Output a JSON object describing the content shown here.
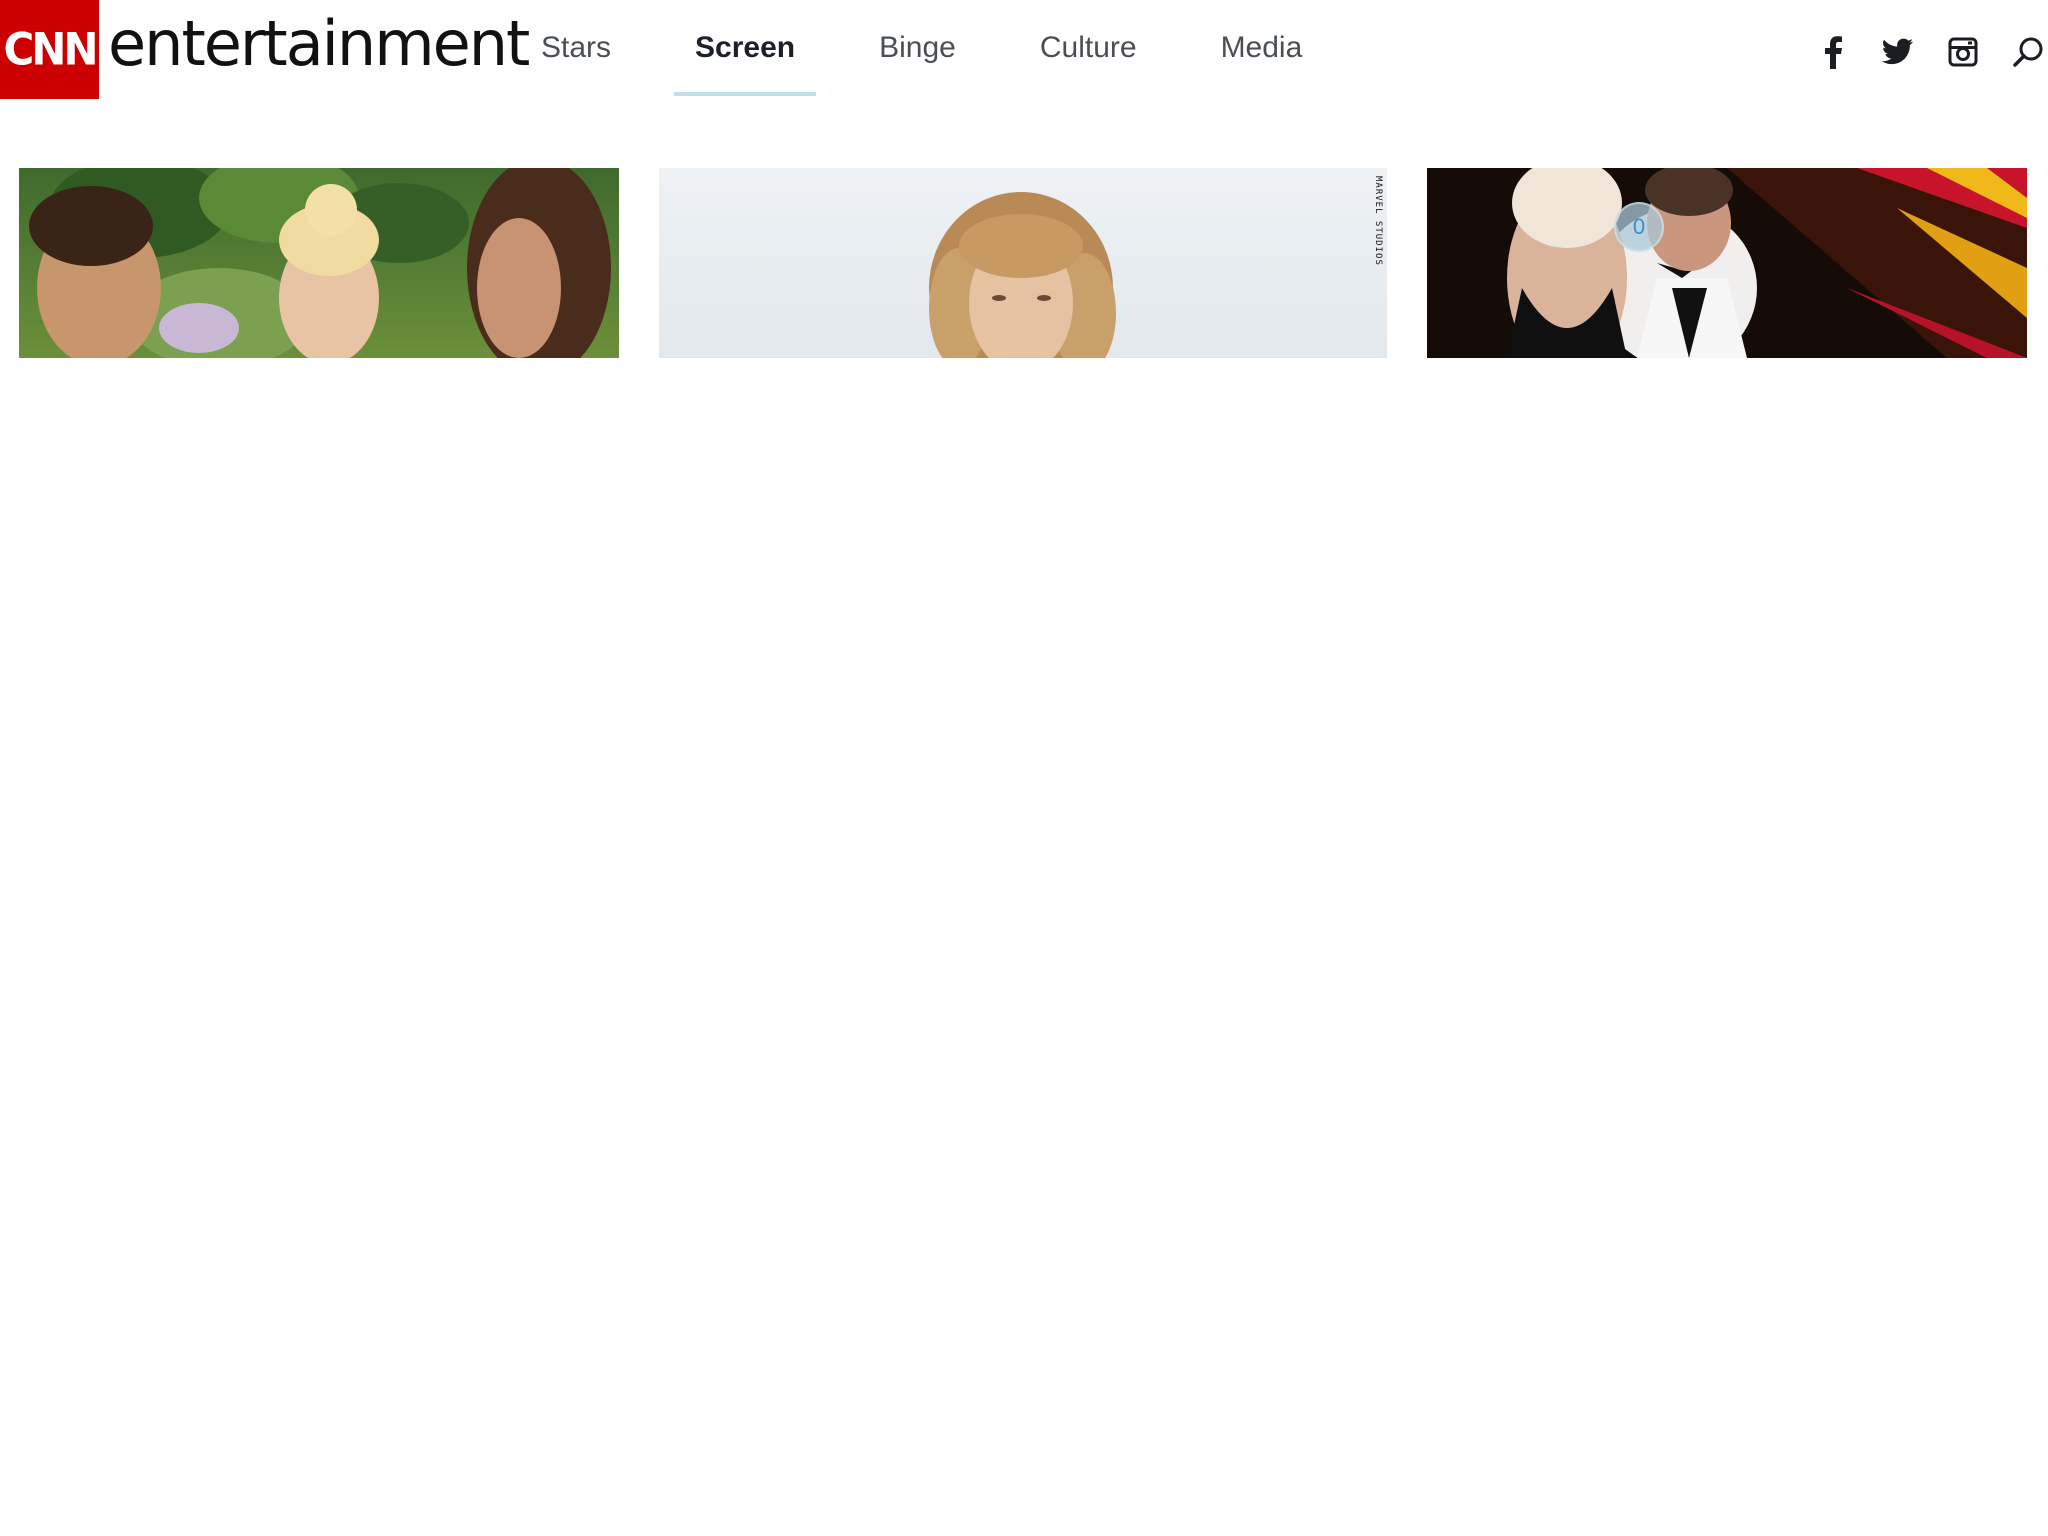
{
  "header": {
    "logo_text": "CNN",
    "brand_word": "entertainment",
    "brand_color": "#cc0000"
  },
  "nav": {
    "items": [
      {
        "label": "Stars"
      },
      {
        "label": "Screen"
      },
      {
        "label": "Binge"
      },
      {
        "label": "Culture"
      },
      {
        "label": "Media"
      }
    ],
    "active": "Screen"
  },
  "social": {
    "icons": [
      "facebook-icon",
      "twitter-icon",
      "instagram-icon",
      "search-icon"
    ]
  },
  "cards": [
    {
      "image": "movie-still-three-people-garden"
    },
    {
      "image": "portrait-woman-curly-hair-bright-sky",
      "credit": "MARVEL STUDIOS"
    },
    {
      "image": "couple-formal-wear-stage",
      "badge": "0"
    }
  ]
}
